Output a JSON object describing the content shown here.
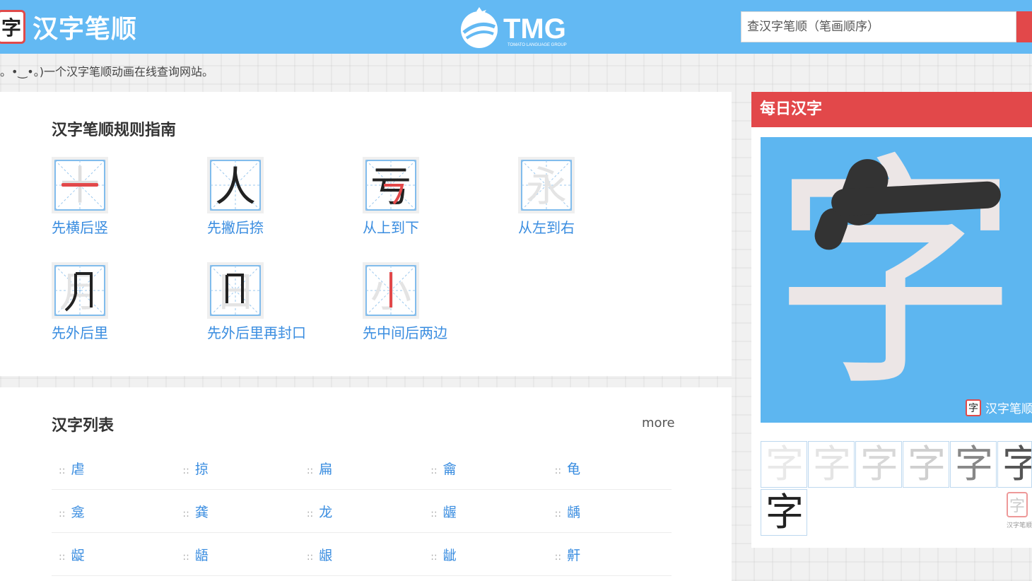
{
  "header": {
    "logo_char": "字",
    "site_title": "汉字笔顺",
    "brand_name": "TMG",
    "brand_sub": "TOMATO LANGUAGE GROUP",
    "search_placeholder": "查汉字笔顺（笔画顺序）"
  },
  "tagline": "。•‿•。)一个汉字笔顺动画在线查询网站。",
  "guide": {
    "title": "汉字笔顺规则指南",
    "rules": [
      {
        "label": "先横后竖",
        "char": "十",
        "highlight": "一"
      },
      {
        "label": "先撇后捺",
        "char": "人",
        "highlight": ""
      },
      {
        "label": "从上到下",
        "char": "亏",
        "highlight": "亏"
      },
      {
        "label": "从左到右",
        "char": "永",
        "highlight": ""
      },
      {
        "label": "先外后里",
        "char": "月",
        "highlight": ""
      },
      {
        "label": "先外后里再封口",
        "char": "日",
        "highlight": ""
      },
      {
        "label": "先中间后两边",
        "char": "小",
        "highlight": "丨"
      }
    ]
  },
  "char_list": {
    "title": "汉字列表",
    "more_label": "more",
    "rows": [
      [
        "虐",
        "掠",
        "扁",
        "龠",
        "龟"
      ],
      [
        "龛",
        "龚",
        "龙",
        "龌",
        "龋"
      ],
      [
        "龊",
        "龉",
        "龈",
        "龇",
        "鼾"
      ]
    ]
  },
  "daily": {
    "title": "每日汉字",
    "char": "字",
    "watermark": "汉字笔顺",
    "watermark_small": "汉字笔顺",
    "steps": [
      "字",
      "字",
      "字",
      "字",
      "字",
      "字",
      "字"
    ]
  },
  "colors": {
    "header_bg": "#63b9f3",
    "accent_red": "#e2484a",
    "link_blue": "#3a8de0",
    "char_card_bg": "#5db6f0"
  }
}
